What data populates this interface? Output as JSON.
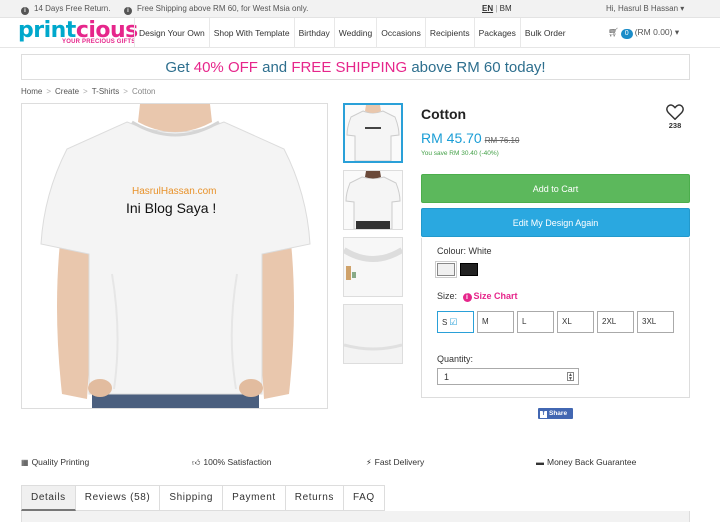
{
  "topbar": {
    "return_text": "14 Days Free Return.",
    "shipping_text": "Free Shipping above RM 60, for West Msia only.",
    "lang_en": "EN",
    "lang_sep": "|",
    "lang_bm": "BM",
    "user_greeting": "Hi, Hasrul B Hassan"
  },
  "logo": {
    "part1": "print",
    "part2": "cious",
    "tagline": "YOUR PRECIOUS GIFTS"
  },
  "nav": {
    "items": [
      "Design Your Own",
      "Shop With Template",
      "Birthday",
      "Wedding",
      "Occasions",
      "Recipients",
      "Packages",
      "Bulk Order"
    ],
    "cart_count": "0",
    "cart_total": "(RM 0.00)"
  },
  "promo": {
    "pre": "Get ",
    "discount": "40% OFF",
    "mid": " and ",
    "free": "FREE SHIPPING",
    "post": " above RM 60 today!"
  },
  "breadcrumb": [
    "Home",
    "Create",
    "T-Shirts",
    "Cotton"
  ],
  "design": {
    "line1": "HasrulHassan.com",
    "line2": "Ini Blog Saya !"
  },
  "product": {
    "title": "Cotton",
    "wishlist_count": "238",
    "price": "RM 45.70",
    "old_price": "RM 76.10",
    "savings": "You save RM 30.40 (-40%)",
    "add_to_cart": "Add to Cart",
    "edit_design": "Edit My Design Again",
    "colour_label": "Colour: White",
    "size_label": "Size:",
    "size_chart": "Size Chart",
    "sizes": [
      "S",
      "M",
      "L",
      "XL",
      "2XL",
      "3XL"
    ],
    "selected_size": "S",
    "quantity_label": "Quantity:",
    "quantity_value": "1",
    "share_label": "Share"
  },
  "features": [
    "Quality Printing",
    "100% Satisfaction",
    "Fast Delivery",
    "Money Back Guarantee"
  ],
  "tabs": [
    "Details",
    "Reviews (58)",
    "Shipping",
    "Payment",
    "Returns",
    "FAQ"
  ],
  "colors": {
    "brand_blue": "#00a8cc",
    "brand_pink": "#e6268b",
    "price_blue": "#1b9ed6",
    "cart_green": "#5cb85c",
    "edit_blue": "#2aa8e0"
  }
}
